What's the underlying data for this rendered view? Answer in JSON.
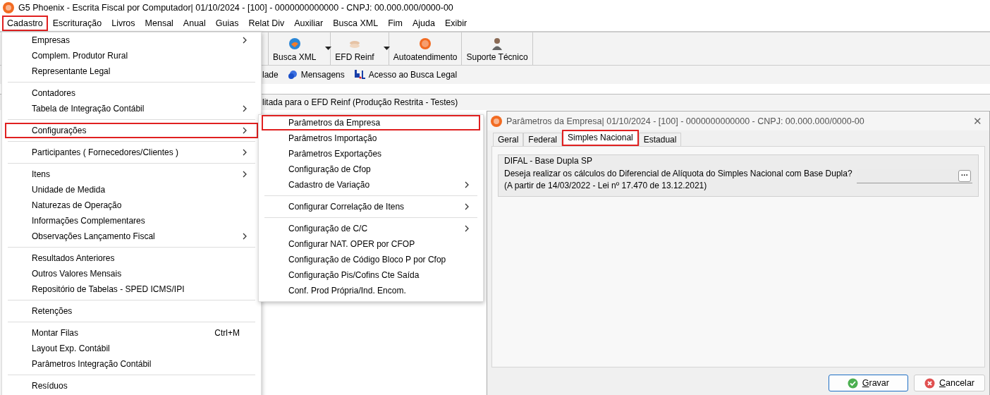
{
  "window": {
    "title": "G5 Phoenix - Escrita Fiscal por Computador|  01/10/2024 - [100] - 0000000000000 - CNPJ: 00.000.000/0000-00"
  },
  "menubar": [
    {
      "label": "Cadastro",
      "selected": true
    },
    {
      "label": "Escrituração",
      "selected": false
    },
    {
      "label": "Livros",
      "selected": false
    },
    {
      "label": "Mensal",
      "selected": false
    },
    {
      "label": "Anual",
      "selected": false
    },
    {
      "label": "Guias",
      "selected": false
    },
    {
      "label": "Relat Div",
      "selected": false
    },
    {
      "label": "Auxiliar",
      "selected": false
    },
    {
      "label": "Busca XML",
      "selected": false
    },
    {
      "label": "Fim",
      "selected": false
    },
    {
      "label": "Ajuda",
      "selected": false
    },
    {
      "label": "Exibir",
      "selected": false
    }
  ],
  "toolbar": [
    {
      "label": "Busca XML",
      "kind": "globe",
      "dropdown": true
    },
    {
      "label": "EFD Reinf",
      "kind": "coins",
      "dropdown": true
    },
    {
      "label": "Autoatendimento",
      "kind": "help",
      "dropdown": false
    },
    {
      "label": "Suporte Técnico",
      "kind": "person",
      "dropdown": false
    }
  ],
  "links": [
    {
      "label": "lade",
      "kind": "plain"
    },
    {
      "label": "Mensagens",
      "kind": "bubble"
    },
    {
      "label": "Acesso ao Busca Legal",
      "kind": "legal"
    }
  ],
  "notice": "litada para o EFD Reinf (Produção Restrita - Testes)",
  "menu": {
    "items": [
      {
        "kind": "item",
        "label": "Empresas",
        "submenu": true,
        "selected": false
      },
      {
        "kind": "item",
        "label": "Complem. Produtor Rural",
        "submenu": false,
        "selected": false
      },
      {
        "kind": "item",
        "label": "Representante Legal",
        "submenu": false,
        "selected": false
      },
      {
        "kind": "separator"
      },
      {
        "kind": "item",
        "label": "Contadores",
        "submenu": false,
        "selected": false
      },
      {
        "kind": "item",
        "label": "Tabela de Integração Contábil",
        "submenu": true,
        "selected": false
      },
      {
        "kind": "separator"
      },
      {
        "kind": "item",
        "label": "Configurações",
        "submenu": true,
        "selected": true
      },
      {
        "kind": "separator"
      },
      {
        "kind": "item",
        "label": "Participantes ( Fornecedores/Clientes )",
        "submenu": true,
        "selected": false
      },
      {
        "kind": "separator"
      },
      {
        "kind": "item",
        "label": "Itens",
        "submenu": true,
        "selected": false
      },
      {
        "kind": "item",
        "label": "Unidade de Medida",
        "submenu": false,
        "selected": false
      },
      {
        "kind": "item",
        "label": "Naturezas de Operação",
        "submenu": false,
        "selected": false
      },
      {
        "kind": "item",
        "label": "Informações Complementares",
        "submenu": false,
        "selected": false
      },
      {
        "kind": "item",
        "label": "Observações Lançamento Fiscal",
        "submenu": true,
        "selected": false
      },
      {
        "kind": "separator"
      },
      {
        "kind": "item",
        "label": "Resultados Anteriores",
        "submenu": false,
        "selected": false
      },
      {
        "kind": "item",
        "label": "Outros Valores Mensais",
        "submenu": false,
        "selected": false
      },
      {
        "kind": "item",
        "label": "Repositório de Tabelas - SPED ICMS/IPI",
        "submenu": false,
        "selected": false
      },
      {
        "kind": "separator"
      },
      {
        "kind": "item",
        "label": "Retenções",
        "submenu": false,
        "selected": false
      },
      {
        "kind": "separator"
      },
      {
        "kind": "item",
        "label": "Montar Filas",
        "submenu": false,
        "selected": false,
        "shortcut": "Ctrl+M"
      },
      {
        "kind": "item",
        "label": "Layout Exp. Contábil",
        "submenu": false,
        "selected": false
      },
      {
        "kind": "item",
        "label": "Parâmetros Integração Contábil",
        "submenu": false,
        "selected": false
      },
      {
        "kind": "separator"
      },
      {
        "kind": "item",
        "label": "Resíduos",
        "submenu": false,
        "selected": false
      }
    ]
  },
  "submenu": {
    "items": [
      {
        "kind": "item",
        "label": "Parâmetros da Empresa",
        "submenu": false,
        "selected": true
      },
      {
        "kind": "item",
        "label": "Parâmetros Importação",
        "submenu": false,
        "selected": false
      },
      {
        "kind": "item",
        "label": "Parâmetros Exportações",
        "submenu": false,
        "selected": false
      },
      {
        "kind": "item",
        "label": "Configuração de Cfop",
        "submenu": false,
        "selected": false
      },
      {
        "kind": "item",
        "label": "Cadastro de Variação",
        "submenu": true,
        "selected": false
      },
      {
        "kind": "separator"
      },
      {
        "kind": "item",
        "label": "Configurar Correlação de Itens",
        "submenu": true,
        "selected": false
      },
      {
        "kind": "separator"
      },
      {
        "kind": "item",
        "label": "Configuração de C/C",
        "submenu": true,
        "selected": false
      },
      {
        "kind": "item",
        "label": "Configurar NAT. OPER por CFOP",
        "submenu": false,
        "selected": false
      },
      {
        "kind": "item",
        "label": "Configuração de Código Bloco P por Cfop",
        "submenu": false,
        "selected": false
      },
      {
        "kind": "item",
        "label": "Configuração Pis/Cofins Cte Saída",
        "submenu": false,
        "selected": false
      },
      {
        "kind": "item",
        "label": "Conf. Prod Própria/Ind. Encom.",
        "submenu": false,
        "selected": false
      }
    ]
  },
  "dialog": {
    "title": "Parâmetros da Empresa|  01/10/2024 - [100] - 0000000000000 - CNPJ: 00.000.000/0000-00",
    "close": "✕",
    "tabs": [
      {
        "label": "Geral",
        "selected": false
      },
      {
        "label": "Federal",
        "selected": false
      },
      {
        "label": "Simples Nacional",
        "selected": true
      },
      {
        "label": "Estadual",
        "selected": false
      }
    ],
    "group": {
      "title": "DIFAL - Base Dupla SP",
      "question": "Deseja realizar os cálculos do Diferencial de Alíquota do Simples Nacional com Base Dupla?",
      "note": "(A partir de 14/03/2022 - Lei nº 17.470 de 13.12.2021)",
      "lookup": "···"
    },
    "buttons": [
      {
        "label": "Gravar",
        "kind": "save"
      },
      {
        "label": "Cancelar",
        "kind": "cancel"
      }
    ]
  }
}
